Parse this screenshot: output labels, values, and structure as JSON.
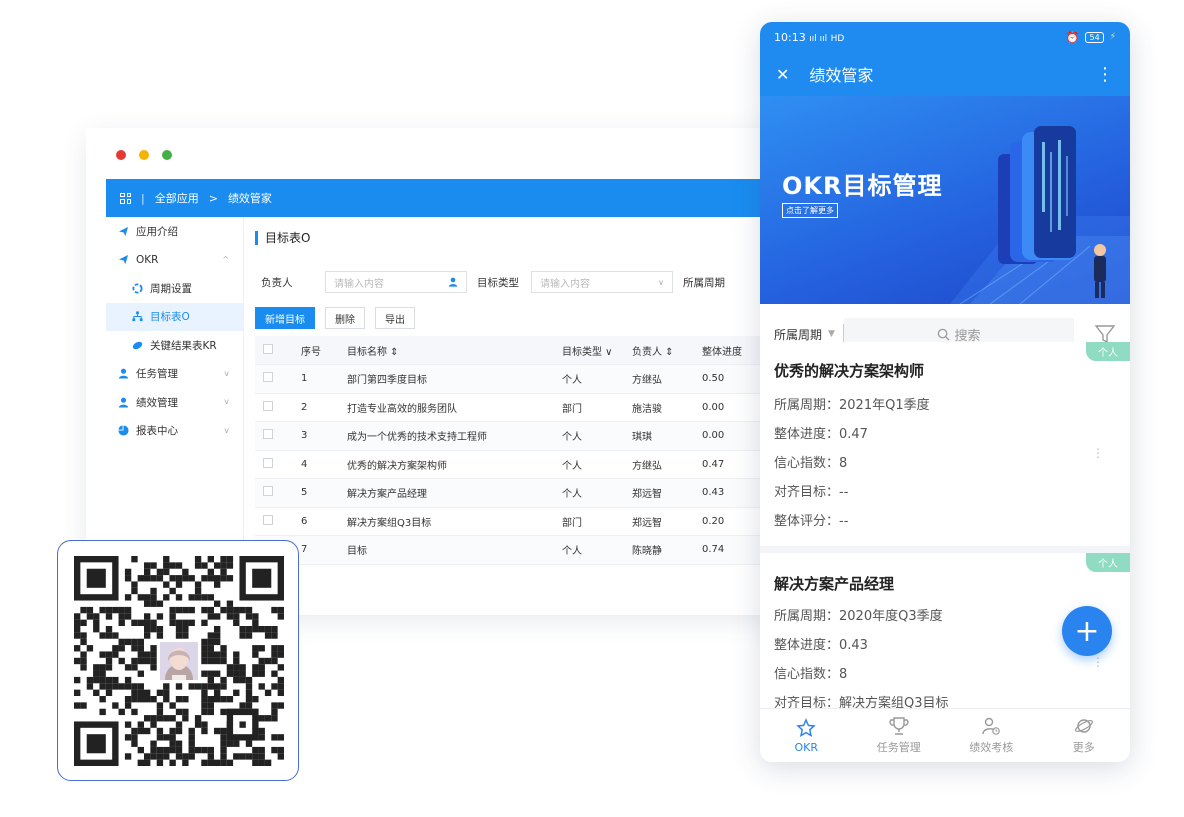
{
  "desktop": {
    "window_dots": [
      "#e53935",
      "#f5b400",
      "#43b047"
    ],
    "breadcrumb": {
      "separator": "|",
      "root": "全部应用",
      "arrow": ">",
      "current": "绩效管家"
    },
    "sidebar": [
      {
        "label": "应用介绍",
        "icon": "send-icon"
      },
      {
        "label": "OKR",
        "icon": "send-icon",
        "chev": "^"
      },
      {
        "label": "周期设置",
        "icon": "cycle-icon",
        "sub": true
      },
      {
        "label": "目标表O",
        "icon": "org-icon",
        "sub": true,
        "active": true
      },
      {
        "label": "关键结果表KR",
        "icon": "key-icon",
        "sub": true
      },
      {
        "label": "任务管理",
        "icon": "person-icon",
        "chev": "v"
      },
      {
        "label": "绩效管理",
        "icon": "person-icon",
        "chev": "v"
      },
      {
        "label": "报表中心",
        "icon": "pie-icon",
        "chev": "v"
      }
    ],
    "page_title": "目标表O",
    "filters": {
      "owner_label": "负责人",
      "owner_placeholder": "请输入内容",
      "type_label": "目标类型",
      "type_placeholder": "请输入内容",
      "period_label": "所属周期"
    },
    "buttons": {
      "add": "新增目标",
      "delete": "删除",
      "export": "导出"
    },
    "table": {
      "headers": [
        "序号",
        "目标名称 ⇕",
        "目标类型 ∨",
        "负责人 ⇕",
        "整体进度"
      ],
      "rows": [
        [
          "1",
          "部门第四季度目标",
          "个人",
          "方继弘",
          "0.50"
        ],
        [
          "2",
          "打造专业高效的服务团队",
          "部门",
          "施洁骏",
          "0.00"
        ],
        [
          "3",
          "成为一个优秀的技术支持工程师",
          "个人",
          "琪琪",
          "0.00"
        ],
        [
          "4",
          "优秀的解决方案架构师",
          "个人",
          "方继弘",
          "0.47"
        ],
        [
          "5",
          "解决方案产品经理",
          "个人",
          "郑远智",
          "0.43"
        ],
        [
          "6",
          "解决方案组Q3目标",
          "部门",
          "郑远智",
          "0.20"
        ],
        [
          "7",
          "目标",
          "个人",
          "陈晓静",
          "0.74"
        ]
      ]
    },
    "accent": "#1a8cf0"
  },
  "phone": {
    "status": {
      "time": "10:13",
      "signal": "ııl ııl",
      "net": "HD",
      "battery": "54"
    },
    "nav": {
      "close": "✕",
      "title": "绩效管家",
      "more": "⋮"
    },
    "banner": {
      "title": "OKR目标管理",
      "subtitle": "点击了解更多"
    },
    "filter": {
      "period": "所属周期",
      "search": "搜索"
    },
    "cards": [
      {
        "tag": "个人",
        "title": "优秀的解决方案架构师",
        "rows": [
          "所属周期：2021年Q1季度",
          "整体进度：0.47",
          "信心指数：8",
          "对齐目标：--",
          "整体评分：--"
        ]
      },
      {
        "tag": "个人",
        "title": "解决方案产品经理",
        "rows": [
          "所属周期：2020年度Q3季度",
          "整体进度：0.43",
          "信心指数：8",
          "对齐目标：解决方案组Q3目标"
        ]
      }
    ],
    "fab": "+",
    "tabs": [
      {
        "label": "OKR",
        "icon": "star-icon",
        "active": true
      },
      {
        "label": "任务管理",
        "icon": "trophy-icon"
      },
      {
        "label": "绩效考核",
        "icon": "user-clock-icon"
      },
      {
        "label": "更多",
        "icon": "planet-icon"
      }
    ],
    "accent": "#1f8bf0",
    "tag_color": "#8fdcc2"
  },
  "qr": {
    "icon": "qr-code-icon",
    "avatar": "avatar-photo"
  }
}
